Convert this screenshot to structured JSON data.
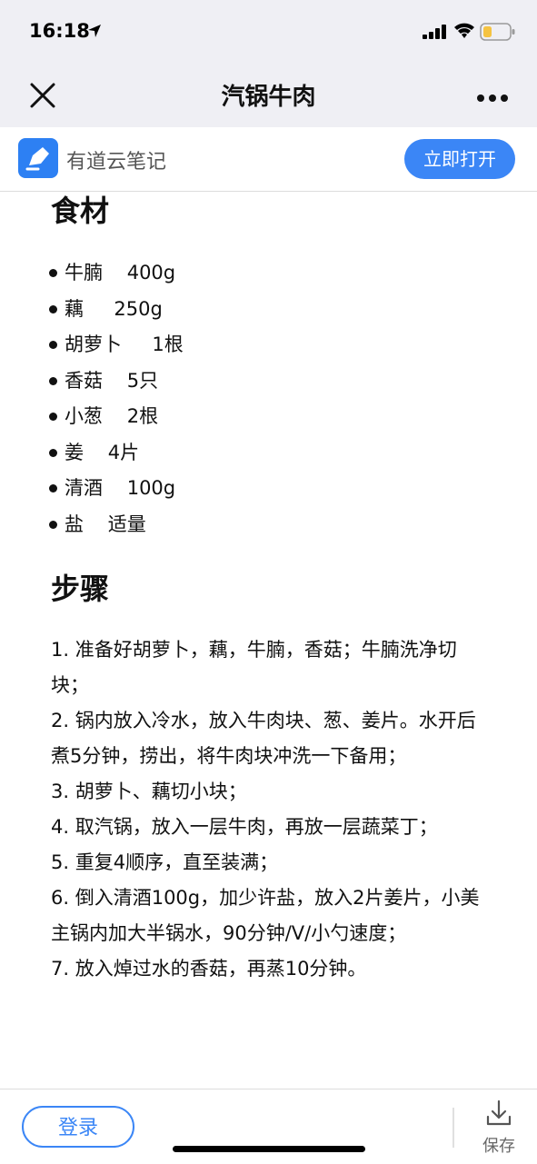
{
  "status_bar": {
    "time": "16:18",
    "icons": [
      "location-arrow-icon",
      "cellular-signal-icon",
      "wifi-icon",
      "battery-low-icon"
    ],
    "battery_color": "#f5c342"
  },
  "nav": {
    "title": "汽锅牛肉",
    "left_icon": "close-icon",
    "right_icon": "more-icon"
  },
  "app_banner": {
    "app_name": "有道云笔记",
    "open_button": "立即打开",
    "accent": "#3b86f6"
  },
  "article": {
    "ingredients_heading": "食材",
    "ingredients": [
      {
        "name": "牛腩",
        "sep": "    ",
        "amount": "400g"
      },
      {
        "name": "藕",
        "sep": "     ",
        "amount": "250g"
      },
      {
        "name": "胡萝卜",
        "sep": "     ",
        "amount": "1根"
      },
      {
        "name": "香菇",
        "sep": "    ",
        "amount": "5只"
      },
      {
        "name": "小葱",
        "sep": "    ",
        "amount": "2根"
      },
      {
        "name": "姜",
        "sep": "    ",
        "amount": "4片"
      },
      {
        "name": "清酒",
        "sep": "    ",
        "amount": "100g"
      },
      {
        "name": "盐",
        "sep": "    ",
        "amount": "适量"
      }
    ],
    "steps_heading": "步骤",
    "steps": [
      "1. 准备好胡萝卜，藕，牛腩，香菇；牛腩洗净切块；",
      "2. 锅内放入冷水，放入牛肉块、葱、姜片。水开后煮5分钟，捞出，将牛肉块冲洗一下备用；",
      "3. 胡萝卜、藕切小块；",
      "4. 取汽锅，放入一层牛肉，再放一层蔬菜丁；",
      "5. 重复4顺序，直至装满；",
      "6. 倒入清酒100g，加少许盐，放入2片姜片，小美主锅内加大半锅水，90分钟/V/小勺速度；",
      "7. 放入焯过水的香菇，再蒸10分钟。"
    ]
  },
  "bottom_bar": {
    "login_button": "登录",
    "save_label": "保存",
    "save_icon": "download-icon"
  }
}
